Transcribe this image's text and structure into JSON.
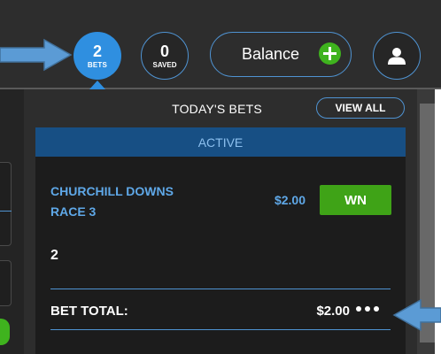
{
  "header": {
    "bets_count": "2",
    "bets_label": "BETS",
    "saved_count": "0",
    "saved_label": "SAVED",
    "balance_label": "Balance",
    "add_funds_icon": "plus-icon",
    "account_icon": "user-icon"
  },
  "panel": {
    "title": "TODAY'S BETS",
    "view_all_label": "VIEW ALL",
    "active_tab_label": "ACTIVE"
  },
  "bet": {
    "track": "CHURCHILL DOWNS",
    "race": "RACE 3",
    "amount": "$2.00",
    "bet_type": "WN",
    "selection": "2",
    "total_label": "BET TOTAL:",
    "total_value": "$2.00",
    "more_icon": "ellipsis-icon"
  },
  "colors": {
    "accent_blue": "#2f8fe0",
    "outline_blue": "#4f93d2",
    "success_green": "#3fa317",
    "background_dark": "#2d2d2d",
    "card_dark": "#1c1c1c",
    "active_tab": "#174f84"
  }
}
